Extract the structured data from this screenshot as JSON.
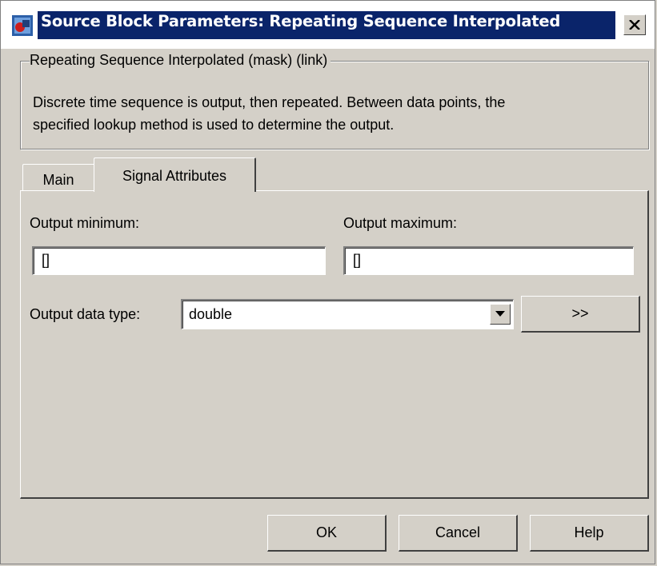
{
  "window": {
    "title": "Source Block Parameters: Repeating Sequence Interpolated",
    "icon": "simulink-block-icon",
    "close_icon": "close-x-icon"
  },
  "group": {
    "legend": "Repeating Sequence Interpolated (mask) (link)",
    "description_line1": "Discrete time sequence is output, then repeated.  Between data points, the",
    "description_line2": "specified lookup method is used to determine the output."
  },
  "tabs": [
    {
      "label": "Main",
      "selected": false
    },
    {
      "label": "Signal Attributes",
      "selected": true
    }
  ],
  "fields": {
    "output_minimum": {
      "label": "Output minimum:",
      "value": "[]"
    },
    "output_maximum": {
      "label": "Output maximum:",
      "value": "[]"
    },
    "output_data_type": {
      "label": "Output data type:",
      "value": "double"
    }
  },
  "buttons": {
    "more": ">>",
    "ok": "OK",
    "cancel": "Cancel",
    "help": "Help"
  },
  "colors": {
    "title_bar": "#0a246a",
    "face": "#d4d0c8"
  }
}
